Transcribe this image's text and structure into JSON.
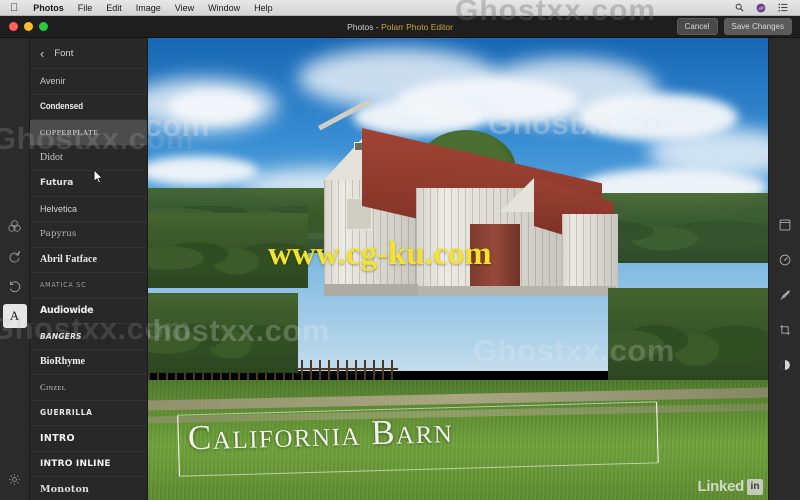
{
  "menubar": {
    "apple_icon": "apple-logo-icon",
    "items": [
      {
        "label": "Photos",
        "bold": true
      },
      {
        "label": "File",
        "bold": false
      },
      {
        "label": "Edit",
        "bold": false
      },
      {
        "label": "Image",
        "bold": false
      },
      {
        "label": "View",
        "bold": false
      },
      {
        "label": "Window",
        "bold": false
      },
      {
        "label": "Help",
        "bold": false
      }
    ],
    "right_icons": [
      "search-icon",
      "siri-icon",
      "control-center-icon"
    ]
  },
  "window": {
    "title_app": "Photos",
    "title_sep": " - ",
    "title_doc": "Polarr Photo Editor",
    "traffic_lights": [
      "close-button",
      "minimize-button",
      "zoom-button"
    ],
    "cancel_label": "Cancel",
    "save_label": "Save Changes"
  },
  "left_rail": {
    "items": [
      {
        "name": "adjust-color-icon",
        "selected": false
      },
      {
        "name": "redo-icon",
        "selected": false
      },
      {
        "name": "undo-icon",
        "selected": false
      },
      {
        "name": "text-tool-icon",
        "glyph": "A",
        "selected": true
      },
      {
        "name": "settings-gear-icon",
        "selected": false
      }
    ]
  },
  "right_rail": {
    "items": [
      {
        "name": "frame-icon"
      },
      {
        "name": "dial-icon"
      },
      {
        "name": "brush-off-icon"
      },
      {
        "name": "crop-icon"
      },
      {
        "name": "contrast-icon"
      }
    ]
  },
  "font_panel": {
    "back_icon": "chevron-left-icon",
    "title": "Font",
    "fonts": [
      {
        "label": "Avenir",
        "style": "f-avenir",
        "selected": false
      },
      {
        "label": "Condensed",
        "style": "f-cond",
        "selected": false
      },
      {
        "label": "Copperplate",
        "style": "f-copper",
        "selected": true
      },
      {
        "label": "Didot",
        "style": "f-didot",
        "selected": false
      },
      {
        "label": "Futura",
        "style": "f-futura",
        "selected": false
      },
      {
        "label": "Helvetica",
        "style": "f-helv",
        "selected": false
      },
      {
        "label": "Papyrus",
        "style": "f-papyrus",
        "selected": false
      },
      {
        "label": "Abril Fatface",
        "style": "f-abril",
        "selected": false
      },
      {
        "label": "Amatica SC",
        "style": "f-amatica",
        "selected": false
      },
      {
        "label": "Audiowide",
        "style": "f-audio",
        "selected": false
      },
      {
        "label": "Bangers",
        "style": "f-bangers",
        "selected": false
      },
      {
        "label": "BioRhyme",
        "style": "f-biorhyme",
        "selected": false
      },
      {
        "label": "Cinzel",
        "style": "f-cinzel",
        "selected": false
      },
      {
        "label": "Guerrilla",
        "style": "f-guerrilla",
        "selected": false
      },
      {
        "label": "Intro",
        "style": "f-intro",
        "selected": false
      },
      {
        "label": "Intro Inline",
        "style": "f-introinl",
        "selected": false
      },
      {
        "label": "Monoton",
        "style": "f-monoton",
        "selected": false
      }
    ]
  },
  "canvas": {
    "overlay_text": "California Barn",
    "photo_description": "white weathered barn with red roof, blue sky, trees, wooden fence and green grass"
  },
  "watermarks": {
    "site_name": "Ghostxx.com",
    "yellow_url": "www.cg-ku.com",
    "linkedin_label": "Linked",
    "linkedin_badge": "in"
  },
  "colors": {
    "window_bg": "#222222",
    "panel_bg": "#282828",
    "rail_bg": "#2b2b2b",
    "titlebar_bg": "#1e1e1e",
    "highlight_row": "#4c4c4c",
    "accent_title": "#c9a24a",
    "yellow_watermark": "#f5e32b",
    "roof_red": "#8e3a2c",
    "grass_green": "#6fa23b",
    "sky_blue": "#3a8fd4"
  }
}
